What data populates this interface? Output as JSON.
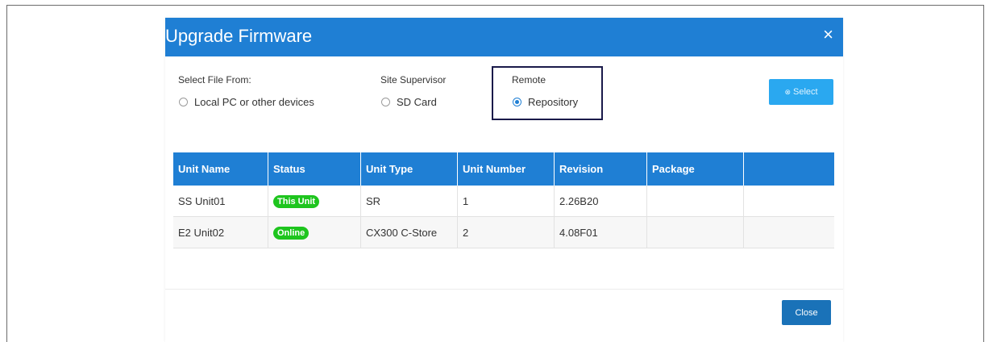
{
  "dialog": {
    "title": "Upgrade Firmware",
    "close_glyph": "×"
  },
  "source": {
    "select_file_label": "Select File From:",
    "local_option": "Local PC or other devices",
    "site_supervisor_label": "Site Supervisor",
    "sd_option": "SD Card",
    "remote_label": "Remote",
    "repository_option": "Repository",
    "selected": "Repository"
  },
  "select_button": {
    "label": "Select",
    "icon": "⊗"
  },
  "table": {
    "headers": [
      "Unit Name",
      "Status",
      "Unit Type",
      "Unit Number",
      "Revision",
      "Package",
      ""
    ],
    "rows": [
      {
        "unit_name": "SS Unit01",
        "status": "This Unit",
        "unit_type": "SR",
        "unit_number": "1",
        "revision": "2.26B20",
        "package": "",
        "extra": ""
      },
      {
        "unit_name": "E2 Unit02",
        "status": "Online",
        "unit_type": "CX300 C-Store",
        "unit_number": "2",
        "revision": "4.08F01",
        "package": "",
        "extra": ""
      }
    ]
  },
  "footer": {
    "close_label": "Close"
  },
  "colors": {
    "header_blue": "#1f7fd4",
    "status_green": "#1ec51e",
    "select_blue": "#2aa8f0",
    "close_blue": "#1a72b8"
  }
}
